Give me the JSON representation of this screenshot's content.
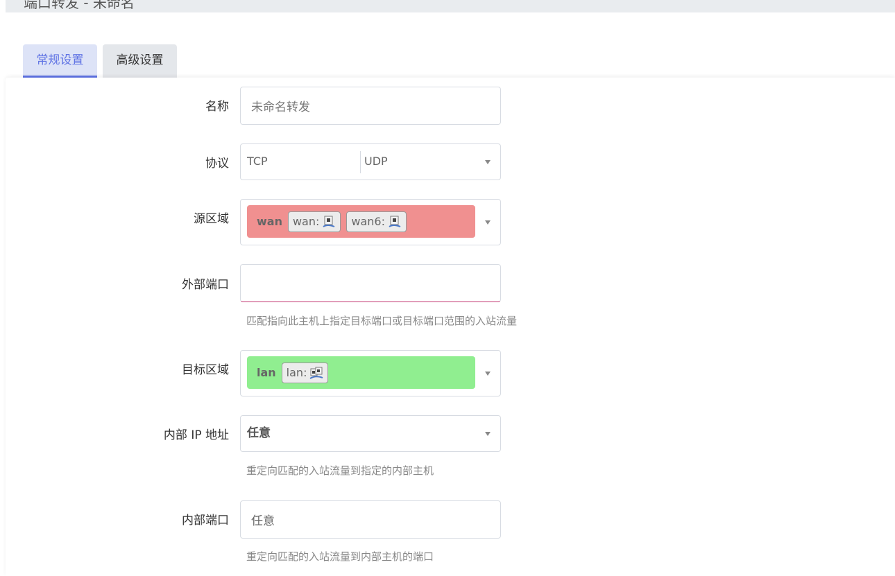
{
  "header": {
    "title_fragment": "端口转发 - 未命名"
  },
  "tabs": [
    {
      "label": "常规设置",
      "active": true
    },
    {
      "label": "高级设置",
      "active": false
    }
  ],
  "form": {
    "name": {
      "label": "名称",
      "placeholder": "未命名转发",
      "value": ""
    },
    "protocol": {
      "label": "协议",
      "values": [
        "TCP",
        "UDP"
      ]
    },
    "source_zone": {
      "label": "源区域",
      "zone": "wan",
      "color": "#f09090",
      "devices": [
        "wan:",
        "wan6:"
      ]
    },
    "external_port": {
      "label": "外部端口",
      "value": "",
      "help": "匹配指向此主机上指定目标端口或目标端口范围的入站流量"
    },
    "dest_zone": {
      "label": "目标区域",
      "zone": "lan",
      "color": "#90ee90",
      "devices": [
        "lan:"
      ]
    },
    "internal_ip": {
      "label": "内部 IP 地址",
      "value": "任意",
      "help": "重定向匹配的入站流量到指定的内部主机"
    },
    "internal_port": {
      "label": "内部端口",
      "placeholder": "任意",
      "help": "重定向匹配的入站流量到内部主机的端口"
    }
  },
  "colors": {
    "accent": "#5e72e4",
    "error_underline": "#c0326e"
  }
}
